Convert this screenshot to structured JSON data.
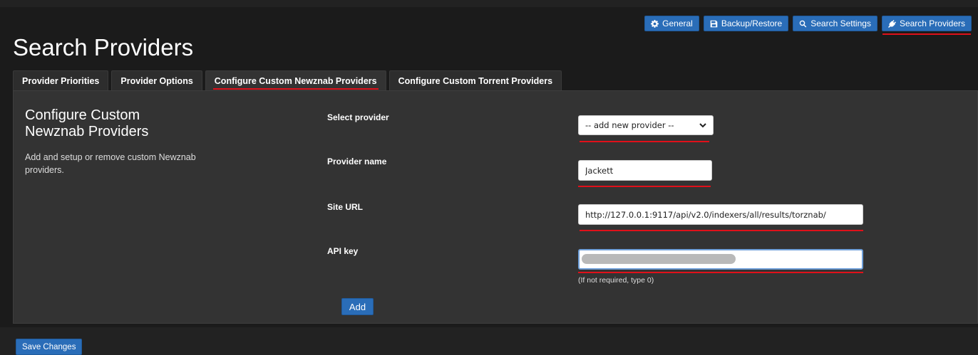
{
  "page_title": "Search Providers",
  "topnav": [
    {
      "label": "General",
      "icon": "gear-icon"
    },
    {
      "label": "Backup/Restore",
      "icon": "floppy-icon"
    },
    {
      "label": "Search Settings",
      "icon": "search-icon"
    },
    {
      "label": "Search Providers",
      "icon": "plug-icon",
      "active": true
    }
  ],
  "tabs": [
    {
      "label": "Provider Priorities"
    },
    {
      "label": "Provider Options"
    },
    {
      "label": "Configure Custom Newznab Providers",
      "active": true
    },
    {
      "label": "Configure Custom Torrent Providers"
    }
  ],
  "panel": {
    "heading": "Configure Custom Newznab Providers",
    "description": "Add and setup or remove custom Newznab providers."
  },
  "form": {
    "select_provider_label": "Select provider",
    "select_provider_value": "-- add new provider --",
    "provider_name_label": "Provider name",
    "provider_name_value": "Jackett",
    "site_url_label": "Site URL",
    "site_url_value": "http://127.0.0.1:9117/api/v2.0/indexers/all/results/torznab/",
    "api_key_label": "API key",
    "api_key_value": "",
    "api_key_hint": "(If not required, type 0)",
    "add_button": "Add"
  },
  "save_button": "Save Changes",
  "colors": {
    "accent": "#2a6db8",
    "highlight_underline": "#e0101a",
    "background": "#222222",
    "panel": "#333333"
  }
}
